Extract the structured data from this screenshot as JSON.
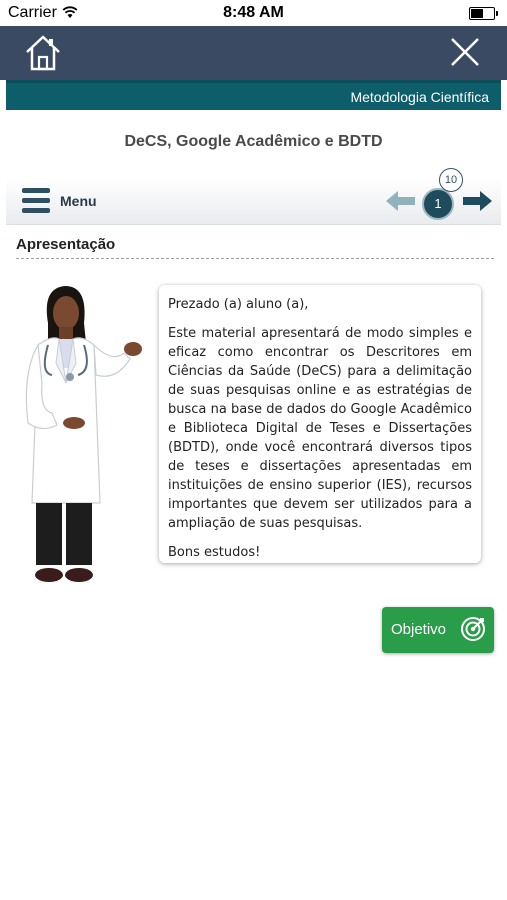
{
  "status_bar": {
    "carrier": "Carrier",
    "time": "8:48 AM"
  },
  "header": {
    "home_icon": "home-icon",
    "close_icon": "close-icon",
    "background_color": "#3b4a63"
  },
  "course": {
    "name": "Metodologia Científica",
    "bar_color": "#0e5d6b"
  },
  "page_title": "DeCS, Google Acadêmico e BDTD",
  "nav": {
    "menu_label": "Menu",
    "current_page": "1",
    "total_pages": "10",
    "prev_icon": "arrow-left-icon",
    "next_icon": "arrow-right-icon"
  },
  "section": {
    "title": "Apresentação"
  },
  "message": {
    "greeting": "Prezado (a) aluno (a),",
    "body": "Este material apresentará de modo simples e eficaz como encontrar os Descritores em Ciências da Saúde (DeCS) para a delimitação de suas pesquisas online e as estratégias de busca na base de dados do Google Acadêmico e Biblioteca Digital de Teses e Dissertações (BDTD), onde você encontrará diversos tipos de teses e dissertações apresentadas em instituições de ensino superior (IES), recursos importantes que devem ser utilizados para a ampliação de suas pesquisas.",
    "closing": "Bons estudos!"
  },
  "objective_button": {
    "label": "Objetivo",
    "icon": "target-icon",
    "color": "#2a9d4a"
  }
}
